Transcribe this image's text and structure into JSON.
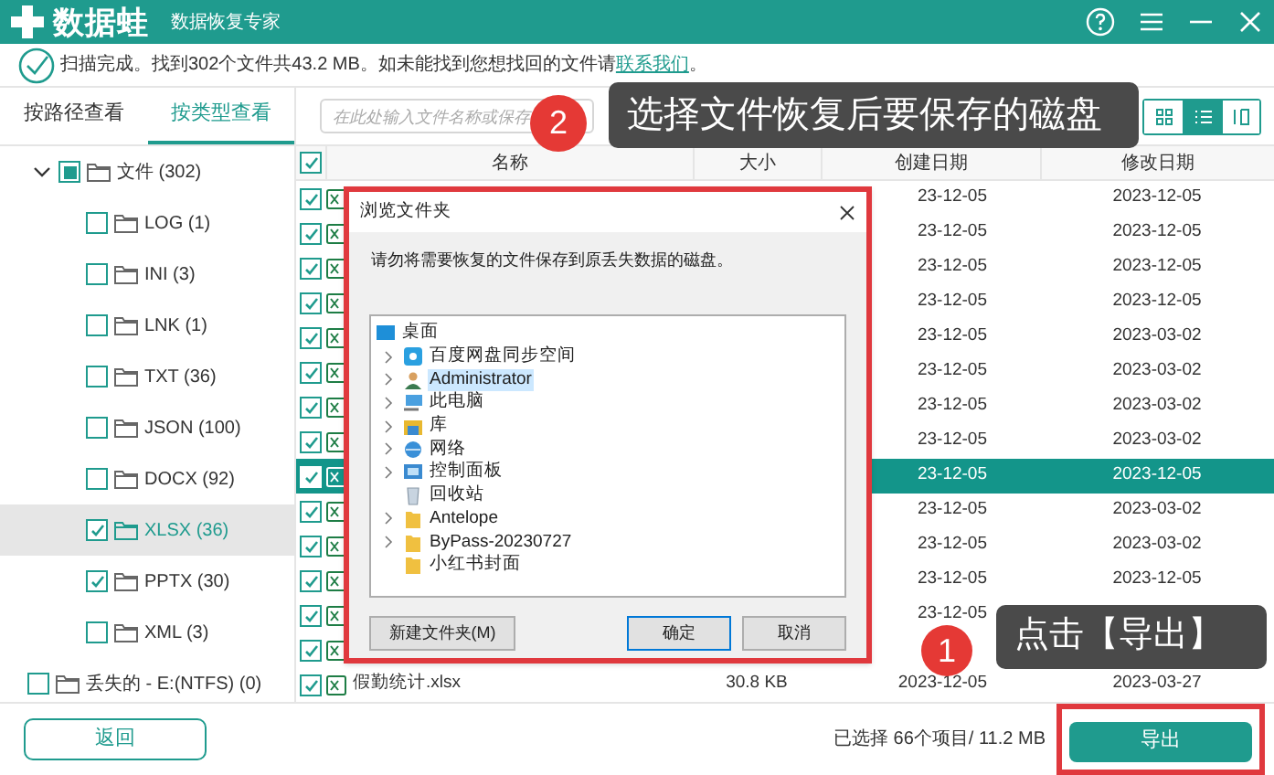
{
  "app": {
    "name": "数据蛙",
    "subtitle": "数据恢复专家"
  },
  "scan_message": {
    "text": "扫描完成。找到302个文件共43.2 MB。如未能找到您想找回的文件请",
    "link": "联系我们",
    "end": "。"
  },
  "tabs": [
    {
      "label": "按路径查看",
      "selected": false
    },
    {
      "label": "按类型查看",
      "selected": true
    }
  ],
  "tree": [
    {
      "label": "文件 (302)",
      "expanded": true,
      "checked": false,
      "partial": true,
      "selected": false,
      "children": [
        {
          "label": "LOG (1)",
          "checked": false,
          "selected": false
        },
        {
          "label": "INI (3)",
          "checked": false,
          "selected": false
        },
        {
          "label": "LNK (1)",
          "checked": false,
          "selected": false
        },
        {
          "label": "TXT (36)",
          "checked": false,
          "selected": false
        },
        {
          "label": "JSON (100)",
          "checked": false,
          "selected": false
        },
        {
          "label": "DOCX (92)",
          "checked": false,
          "selected": false
        },
        {
          "label": "XLSX (36)",
          "checked": true,
          "selected": true
        },
        {
          "label": "PPTX (30)",
          "checked": true,
          "selected": false
        },
        {
          "label": "XML (3)",
          "checked": false,
          "selected": false
        }
      ]
    },
    {
      "label": "丢失的 - E:(NTFS) (0)",
      "checked": false,
      "partial": false,
      "selected": false
    }
  ],
  "back_button": "返回",
  "search": {
    "placeholder": "在此处输入文件名称或保存"
  },
  "view_modes": [
    {
      "kind": "grid",
      "selected": false
    },
    {
      "kind": "list",
      "selected": true
    },
    {
      "kind": "columns",
      "selected": false
    }
  ],
  "table": {
    "all_checked": true,
    "columns": [
      "名称",
      "大小",
      "创建日期",
      "修改日期"
    ],
    "rows": [
      {
        "checked": true,
        "selected": false,
        "created": "23-12-05",
        "modified": "2023-12-05"
      },
      {
        "checked": true,
        "selected": false,
        "created": "23-12-05",
        "modified": "2023-12-05"
      },
      {
        "checked": true,
        "selected": false,
        "created": "23-12-05",
        "modified": "2023-12-05"
      },
      {
        "checked": true,
        "selected": false,
        "created": "23-12-05",
        "modified": "2023-12-05"
      },
      {
        "checked": true,
        "selected": false,
        "created": "23-12-05",
        "modified": "2023-03-02"
      },
      {
        "checked": true,
        "selected": false,
        "created": "23-12-05",
        "modified": "2023-03-02"
      },
      {
        "checked": true,
        "selected": false,
        "created": "23-12-05",
        "modified": "2023-03-02"
      },
      {
        "checked": true,
        "selected": false,
        "created": "23-12-05",
        "modified": "2023-03-02"
      },
      {
        "checked": true,
        "selected": true,
        "created": "23-12-05",
        "modified": "2023-12-05"
      },
      {
        "checked": true,
        "selected": false,
        "created": "23-12-05",
        "modified": "2023-03-02"
      },
      {
        "checked": true,
        "selected": false,
        "created": "23-12-05",
        "modified": "2023-03-02"
      },
      {
        "checked": true,
        "selected": false,
        "created": "23-12-05",
        "modified": "2023-12-05"
      },
      {
        "checked": true,
        "selected": false,
        "created": "23-12-05"
      },
      {
        "checked": true,
        "selected": false
      },
      {
        "checked": true,
        "selected": false,
        "name": "假勤统计.xlsx",
        "size": "30.8 KB",
        "created": "2023-12-05",
        "modified": "2023-03-27"
      }
    ]
  },
  "selection_summary": "已选择 66个项目/ 11.2 MB",
  "export_button": "导出",
  "dialog": {
    "title": "浏览文件夹",
    "message": "请勿将需要恢复的文件保存到原丢失数据的磁盘。",
    "tree": [
      {
        "label": "桌面",
        "kind": "desktop",
        "selected": false,
        "children": [
          {
            "label": "百度网盘同步空间",
            "kind": "cloud",
            "has_children": true,
            "selected": false
          },
          {
            "label": "Administrator",
            "kind": "user",
            "has_children": true,
            "selected": true
          },
          {
            "label": "此电脑",
            "kind": "computer",
            "has_children": true,
            "selected": false
          },
          {
            "label": "库",
            "kind": "library",
            "has_children": true,
            "selected": false
          },
          {
            "label": "网络",
            "kind": "network",
            "has_children": true,
            "selected": false
          },
          {
            "label": "控制面板",
            "kind": "control-panel",
            "has_children": true,
            "selected": false
          },
          {
            "label": "回收站",
            "kind": "recycle-bin",
            "has_children": false,
            "selected": false
          },
          {
            "label": "Antelope",
            "kind": "folder",
            "has_children": true,
            "selected": false
          },
          {
            "label": "ByPass-20230727",
            "kind": "folder",
            "has_children": true,
            "selected": false
          },
          {
            "label": "小红书封面",
            "kind": "folder",
            "has_children": false,
            "selected": false
          }
        ]
      }
    ],
    "buttons": [
      {
        "label": "新建文件夹(M)",
        "default": false
      },
      {
        "label": "确定",
        "default": true
      },
      {
        "label": "取消",
        "default": false
      }
    ]
  },
  "callouts": [
    {
      "number": "2",
      "text": "选择文件恢复后要保存的磁盘"
    },
    {
      "number": "1",
      "text": "点击【导出】"
    }
  ]
}
